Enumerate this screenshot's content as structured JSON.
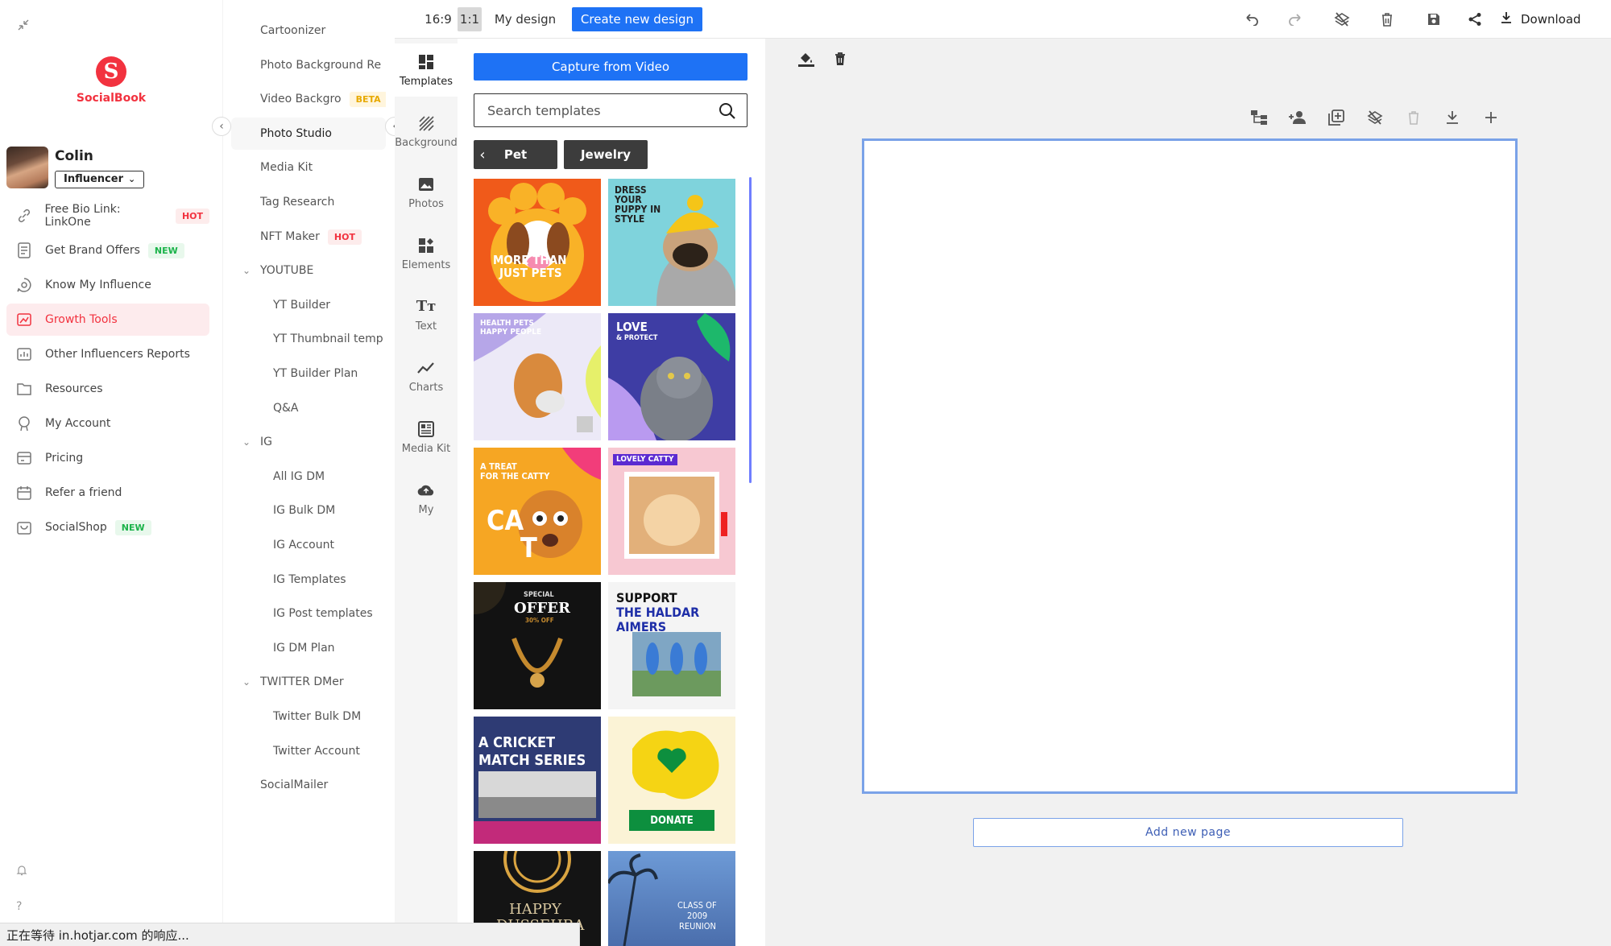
{
  "sidebar": {
    "brand": "SocialBook",
    "user": {
      "name": "Colin",
      "role": "Influencer"
    },
    "items": [
      {
        "label": "Free Bio Link: LinkOne",
        "badge": "HOT",
        "icon": "link-icon"
      },
      {
        "label": "Get Brand Offers",
        "badge": "NEW",
        "icon": "document-icon"
      },
      {
        "label": "Know My Influence",
        "badge": "",
        "icon": "chat-search-icon"
      },
      {
        "label": "Growth Tools",
        "badge": "",
        "icon": "growth-icon",
        "active": true
      },
      {
        "label": "Other Influencers Reports",
        "badge": "",
        "icon": "report-icon"
      },
      {
        "label": "Resources",
        "badge": "",
        "icon": "folder-icon"
      },
      {
        "label": "My Account",
        "badge": "",
        "icon": "account-icon"
      },
      {
        "label": "Pricing",
        "badge": "",
        "icon": "pricing-icon"
      },
      {
        "label": "Refer a friend",
        "badge": "",
        "icon": "calendar-icon"
      },
      {
        "label": "SocialShop",
        "badge": "NEW",
        "icon": "shop-icon"
      }
    ]
  },
  "submenu": {
    "items": [
      {
        "label": "Cartoonizer"
      },
      {
        "label": "Photo Background Re"
      },
      {
        "label": "Video Backgro",
        "badge": "BETA"
      },
      {
        "label": "Photo Studio",
        "active": true
      },
      {
        "label": "Media Kit"
      },
      {
        "label": "Tag Research"
      },
      {
        "label": "NFT Maker",
        "badge": "HOT"
      },
      {
        "label": "YOUTUBE",
        "section": true
      },
      {
        "label": "YT Builder",
        "level": 2
      },
      {
        "label": "YT Thumbnail temp",
        "level": 2
      },
      {
        "label": "YT Builder Plan",
        "level": 2
      },
      {
        "label": "Q&A",
        "level": 2
      },
      {
        "label": "IG",
        "section": true
      },
      {
        "label": "All IG DM",
        "level": 2
      },
      {
        "label": "IG Bulk DM",
        "level": 2
      },
      {
        "label": "IG Account",
        "level": 2
      },
      {
        "label": "IG Templates",
        "level": 2
      },
      {
        "label": "IG Post templates",
        "level": 2
      },
      {
        "label": "IG DM Plan",
        "level": 2
      },
      {
        "label": "TWITTER DMer",
        "section": true
      },
      {
        "label": "Twitter Bulk DM",
        "level": 2
      },
      {
        "label": "Twitter Account",
        "level": 2
      },
      {
        "label": "SocialMailer"
      }
    ]
  },
  "topbar": {
    "ratio_wide": "16:9",
    "ratio_square": "1:1",
    "my_design": "My design",
    "create_new": "Create new design",
    "download": "Download"
  },
  "tools": [
    {
      "label": "Templates",
      "icon": "templates-icon",
      "active": true
    },
    {
      "label": "Background",
      "icon": "background-icon"
    },
    {
      "label": "Photos",
      "icon": "photos-icon"
    },
    {
      "label": "Elements",
      "icon": "elements-icon"
    },
    {
      "label": "Text",
      "icon": "text-icon"
    },
    {
      "label": "Charts",
      "icon": "charts-icon"
    },
    {
      "label": "Media Kit",
      "icon": "media-kit-icon"
    },
    {
      "label": "My",
      "icon": "cloud-upload-icon"
    }
  ],
  "panel": {
    "capture_button": "Capture from Video",
    "search_placeholder": "Search templates",
    "categories": [
      "Pet",
      "Jewelry"
    ],
    "templates": [
      {
        "name": "more-than-just-pets",
        "lines": [
          "MORE THAN",
          "JUST PETS"
        ]
      },
      {
        "name": "dress-your-puppy",
        "lines": [
          "DRESS",
          "YOUR",
          "PUPPY IN",
          "STYLE"
        ]
      },
      {
        "name": "health-pets-happy-people",
        "lines": [
          "HEALTH PETS",
          "HAPPY PEOPLE"
        ]
      },
      {
        "name": "love-and-protect",
        "lines": [
          "LOVE",
          "& PROTECT"
        ]
      },
      {
        "name": "a-treat-for-the-catty",
        "lines": [
          "A TREAT",
          "FOR THE CATTY",
          "CA",
          "T"
        ]
      },
      {
        "name": "lovely-catty",
        "lines": [
          "LOVELY CATTY"
        ]
      },
      {
        "name": "special-offer",
        "lines": [
          "SPECIAL",
          "OFFER",
          "30% OFF"
        ]
      },
      {
        "name": "support-the-haldar-aimers",
        "lines": [
          "SUPPORT",
          "THE HALDAR",
          "AIMERS"
        ]
      },
      {
        "name": "a-cricket-match-series",
        "lines": [
          "A CRICKET",
          "MATCH SERIES"
        ]
      },
      {
        "name": "donate",
        "lines": [
          "DONATE"
        ]
      },
      {
        "name": "happy-dussehra",
        "lines": [
          "HAPPY",
          "DUSSEHRA"
        ]
      },
      {
        "name": "class-of-2009-reunion",
        "lines": [
          "CLASS OF",
          "2009",
          "REUNION"
        ]
      }
    ]
  },
  "canvas": {
    "add_page": "Add new page"
  },
  "status_bar": "正在等待 in.hotjar.com 的响应...",
  "colors": {
    "brand_red": "#f2323f",
    "primary_blue": "#1e72f5",
    "canvas_border": "#7aa2e8"
  }
}
